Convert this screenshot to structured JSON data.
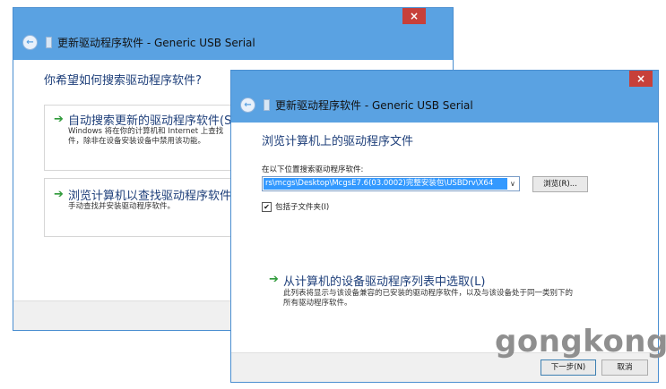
{
  "back_window": {
    "title": "更新驱动程序软件 - Generic USB Serial",
    "close_symbol": "×",
    "back_symbol": "←",
    "heading": "你希望如何搜索驱动程序软件?",
    "option1": {
      "title": "自动搜索更新的驱动程序软件(S)",
      "desc_line1": "Windows 将在你的计算机和 Internet 上查找",
      "desc_line2": "件，除非在设备安装设备中禁用该功能。"
    },
    "option2": {
      "title": "浏览计算机以查找驱动程序软件(R)",
      "desc_line1": "手动查找并安装驱动程序软件。"
    }
  },
  "front_window": {
    "title": "更新驱动程序软件 - Generic USB Serial",
    "close_symbol": "×",
    "back_symbol": "←",
    "heading": "浏览计算机上的驱动程序文件",
    "location_label": "在以下位置搜索驱动程序软件:",
    "path_value": "rs\\mcgs\\Desktop\\McgsE7.6(03.0002)完整安装包\\USBDrv\\X64",
    "dropdown_symbol": "∨",
    "browse_label": "浏览(R)...",
    "checkbox_mark": "✔",
    "checkbox_label": "包括子文件夹(I)",
    "option": {
      "title": "从计算机的设备驱动程序列表中选取(L)",
      "desc_line1": "此列表将显示与该设备兼容的已安装的驱动程序软件，以及与该设备处于同一类别下的",
      "desc_line2": "所有驱动程序软件。"
    },
    "next_label": "下一步(N)",
    "cancel_label": "取消"
  },
  "watermark": "gongkong",
  "colors": {
    "frame": "#5aa2e2",
    "close": "#c7403a",
    "heading": "#1e3f7a",
    "arrow_green": "#2f9a3a",
    "selection": "#3399ff"
  }
}
